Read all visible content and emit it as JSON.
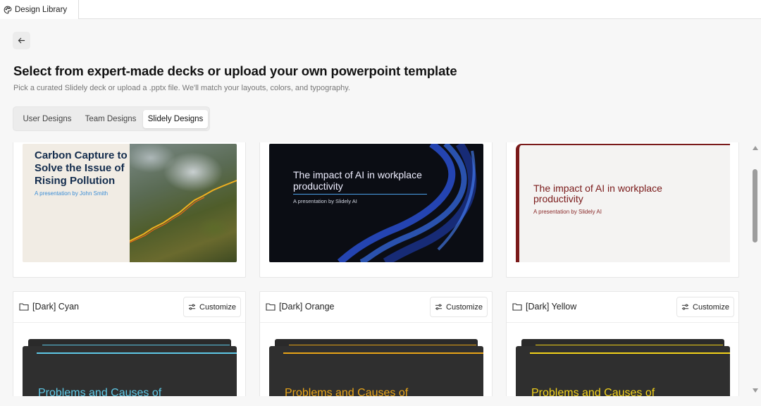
{
  "app_tab": {
    "label": "Design Library",
    "icon": "palette-icon"
  },
  "page": {
    "title": "Select from expert-made decks or upload your own powerpoint template",
    "subtitle": "Pick a curated Slidely deck or upload a .pptx file. We'll match your layouts, colors, and typography."
  },
  "tabs": [
    {
      "label": "User Designs",
      "active": false
    },
    {
      "label": "Team Designs",
      "active": false
    },
    {
      "label": "Slidely Designs",
      "active": true
    }
  ],
  "top_cards": [
    {
      "head": "Carbon Capture to Solve the Issue of Rising Pollution",
      "byline": "A presentation by John Smith"
    },
    {
      "head": "The impact of AI in workplace productivity",
      "byline": "A presentation by Slidely AI"
    },
    {
      "head": "The impact of AI in workplace productivity",
      "byline": "A presentation by Slidely AI"
    }
  ],
  "design_cards": [
    {
      "name": "[Dark] Cyan",
      "customize_label": "Customize",
      "preview_title": "Problems and Causes of",
      "accent": "#5ec8e6"
    },
    {
      "name": "[Dark] Orange",
      "customize_label": "Customize",
      "preview_title": "Problems and Causes of",
      "accent": "#e8a418"
    },
    {
      "name": "[Dark] Yellow",
      "customize_label": "Customize",
      "preview_title": "Problems and Causes of",
      "accent": "#f2d21a"
    }
  ]
}
